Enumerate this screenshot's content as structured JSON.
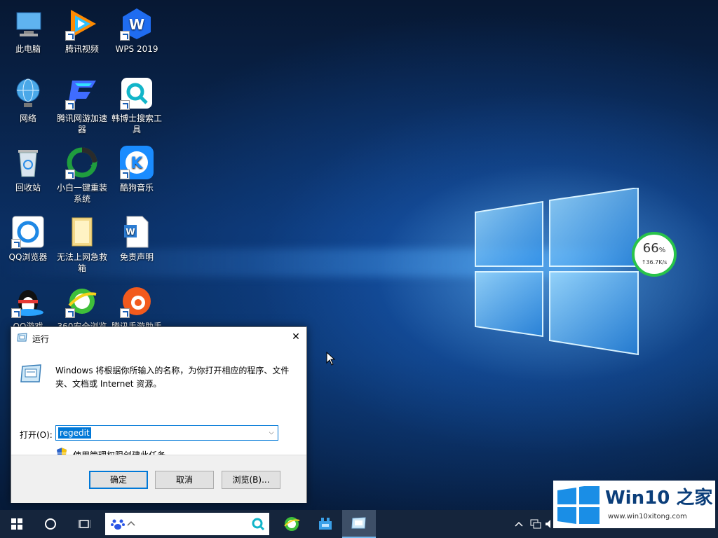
{
  "desktop": {
    "icons": [
      {
        "label": "此电脑"
      },
      {
        "label": "腾讯视频"
      },
      {
        "label": "WPS 2019"
      },
      {
        "label": "网络"
      },
      {
        "label": "腾讯网游加速器"
      },
      {
        "label": "韩博士搜索工具"
      },
      {
        "label": "回收站"
      },
      {
        "label": "小白一键重装系统"
      },
      {
        "label": "酷狗音乐"
      },
      {
        "label": "QQ浏览器"
      },
      {
        "label": "无法上网急救箱"
      },
      {
        "label": "免责声明"
      },
      {
        "label": "QQ游戏"
      },
      {
        "label": "360安全浏览"
      },
      {
        "label": "腾讯手游助手"
      }
    ]
  },
  "run_dialog": {
    "title": "运行",
    "close_glyph": "✕",
    "description": "Windows 将根据你所输入的名称，为你打开相应的程序、文件夹、文档或 Internet 资源。",
    "open_label": "打开(O):",
    "input_value": "regedit",
    "dropdown_glyph": "⌵",
    "admin_note": "使用管理权限创建此任务。",
    "ok_label": "确定",
    "cancel_label": "取消",
    "browse_label": "浏览(B)..."
  },
  "net_widget": {
    "percent": "66",
    "percent_unit": "%",
    "speed": "↑36.7K/s"
  },
  "watermark": {
    "brand": "Win10 之家",
    "url": "www.win10xitong.com"
  },
  "colors": {
    "accent": "#0078d7",
    "taskbar": "#15253c",
    "net_ring": "#29c34a"
  }
}
